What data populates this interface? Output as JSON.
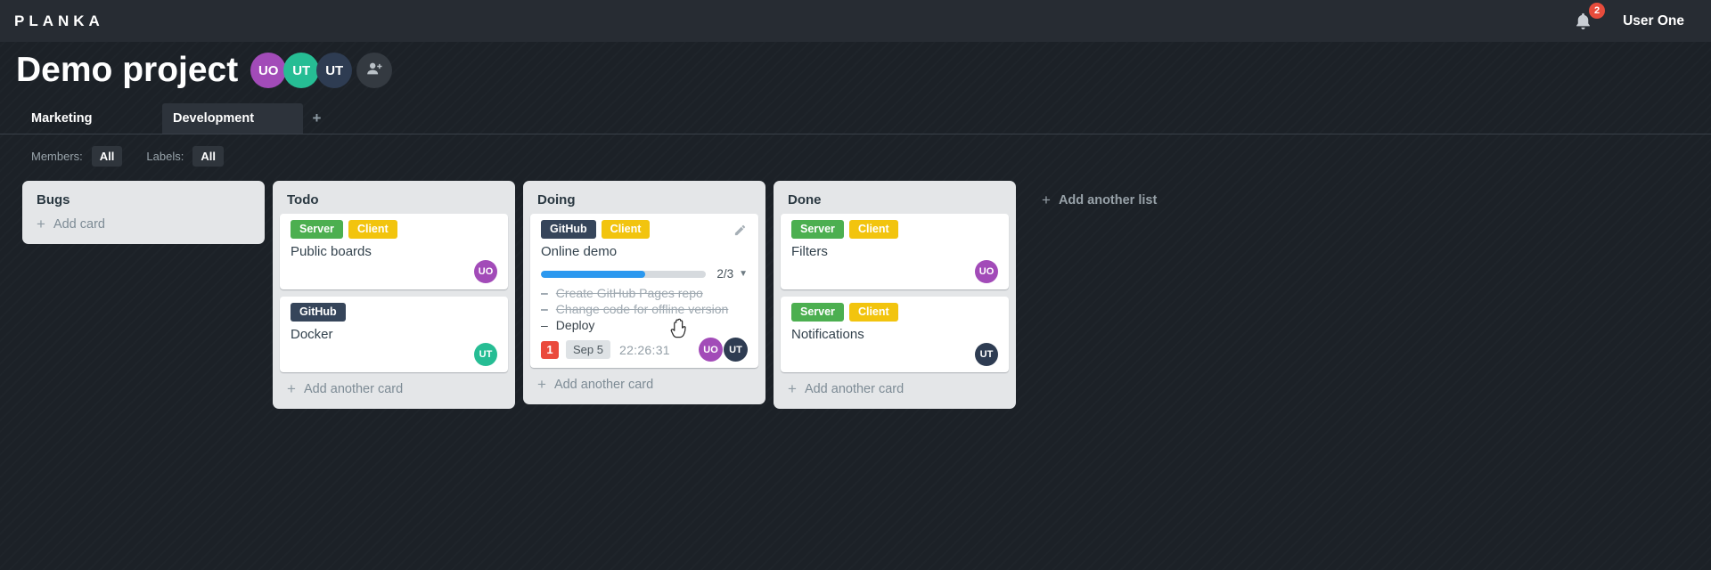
{
  "topbar": {
    "logo": "PLANKA",
    "notification_count": "2",
    "user_name": "User One"
  },
  "project": {
    "title": "Demo project",
    "members": [
      {
        "initials": "UO",
        "color": "#a24bb8"
      },
      {
        "initials": "UT",
        "color": "#26bd94"
      },
      {
        "initials": "UT",
        "color": "#2e3c52"
      }
    ]
  },
  "tabs": {
    "items": [
      {
        "label": "Marketing",
        "active": false
      },
      {
        "label": "Development",
        "active": true
      }
    ]
  },
  "filters": {
    "members_label": "Members:",
    "members_value": "All",
    "labels_label": "Labels:",
    "labels_value": "All"
  },
  "board": {
    "add_list_label": "Add another list",
    "lists": [
      {
        "title": "Bugs",
        "footer_label": "Add card",
        "cards": []
      },
      {
        "title": "Todo",
        "footer_label": "Add another card",
        "cards": [
          {
            "title": "Public boards",
            "labels": [
              {
                "text": "Server",
                "color": "#4caf50"
              },
              {
                "text": "Client",
                "color": "#f2c40e"
              }
            ],
            "members": [
              {
                "initials": "UO",
                "color": "#a24bb8"
              }
            ]
          },
          {
            "title": "Docker",
            "labels": [
              {
                "text": "GitHub",
                "color": "#36455a"
              }
            ],
            "members": [
              {
                "initials": "UT",
                "color": "#26bd94"
              }
            ]
          }
        ]
      },
      {
        "title": "Doing",
        "footer_label": "Add another card",
        "cards": [
          {
            "title": "Online demo",
            "editable": true,
            "labels": [
              {
                "text": "GitHub",
                "color": "#36455a"
              },
              {
                "text": "Client",
                "color": "#f2c40e"
              }
            ],
            "progress": {
              "display": "2/3",
              "percent": 63
            },
            "tasks": [
              {
                "text": "Create GitHub Pages repo",
                "done": true
              },
              {
                "text": "Change code for offline version",
                "done": true
              },
              {
                "text": "Deploy",
                "done": false
              }
            ],
            "notification_count": "1",
            "due_date": "Sep 5",
            "timer": "22:26:31",
            "members": [
              {
                "initials": "UO",
                "color": "#a24bb8"
              },
              {
                "initials": "UT",
                "color": "#2e3c52"
              }
            ]
          }
        ]
      },
      {
        "title": "Done",
        "footer_label": "Add another card",
        "cards": [
          {
            "title": "Filters",
            "labels": [
              {
                "text": "Server",
                "color": "#4caf50"
              },
              {
                "text": "Client",
                "color": "#f2c40e"
              }
            ],
            "members": [
              {
                "initials": "UO",
                "color": "#a24bb8"
              }
            ]
          },
          {
            "title": "Notifications",
            "labels": [
              {
                "text": "Server",
                "color": "#4caf50"
              },
              {
                "text": "Client",
                "color": "#f2c40e"
              }
            ],
            "members": [
              {
                "initials": "UT",
                "color": "#2e3c52"
              }
            ]
          }
        ]
      }
    ]
  },
  "colors": {
    "topbar_bg": "#272c33",
    "page_bg": "#1c2127",
    "list_bg": "#e4e6e8",
    "accent_blue": "#2b98ef",
    "notification_red": "#e74c3c",
    "overdue_red": "#ea4a3c"
  }
}
